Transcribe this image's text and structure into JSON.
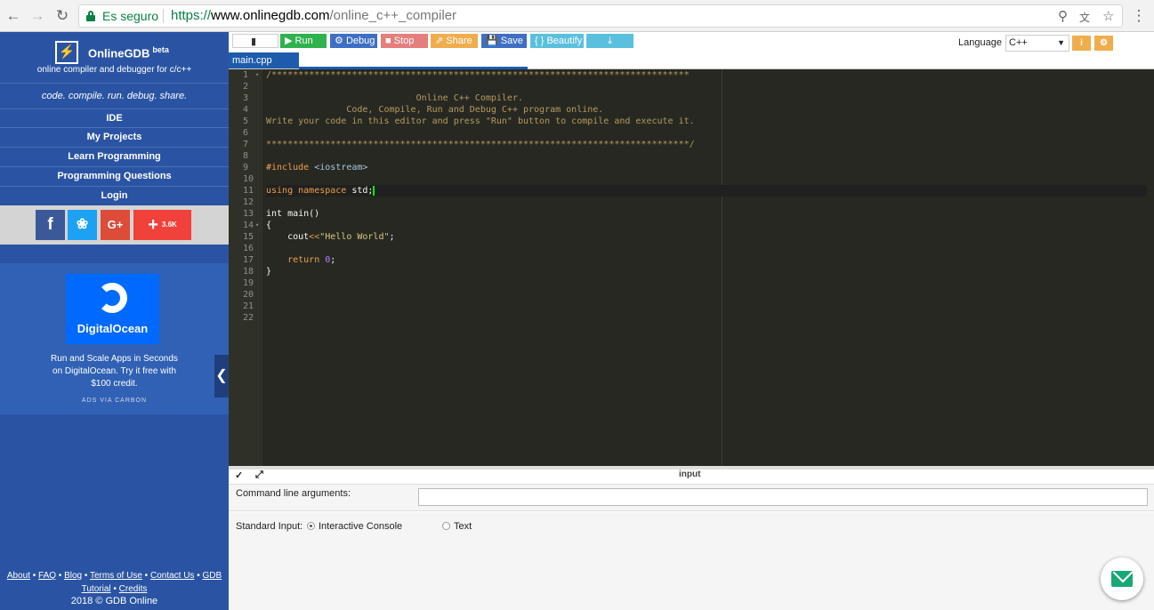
{
  "browser": {
    "security_label": "Es seguro",
    "url_scheme": "https://",
    "url_host": "www.onlinegdb.com",
    "url_path": "/online_c++_compiler"
  },
  "sidebar": {
    "brand": "OnlineGDB",
    "brand_sup": "beta",
    "subtitle": "online compiler and debugger for c/c++",
    "tagline": "code. compile. run. debug. share.",
    "menu": [
      {
        "label": "IDE"
      },
      {
        "label": "My Projects"
      },
      {
        "label": "Learn Programming"
      },
      {
        "label": "Programming Questions"
      },
      {
        "label": "Login"
      }
    ],
    "share_count": "3.6K",
    "ad": {
      "brand": "DigitalOcean",
      "text": "Run and Scale Apps in Seconds on DigitalOcean. Try it free with $100 credit.",
      "via": "ADS VIA CARBON"
    },
    "footer_links": [
      "About",
      "FAQ",
      "Blog",
      "Terms of Use",
      "Contact Us",
      "GDB Tutorial",
      "Credits"
    ],
    "copyright": "2018 © GDB Online"
  },
  "toolbar": {
    "run": "Run",
    "debug": "Debug",
    "stop": "Stop",
    "share": "Share",
    "save": "Save",
    "beautify": "{ } Beautify",
    "language_label": "Language",
    "language_value": "C++",
    "colors": {
      "run": "#2eb24e",
      "debug": "#3e6fc4",
      "stop": "#e57f7d",
      "share": "#f0ad4e",
      "save": "#3e6fc4",
      "beautify": "#5bc0de",
      "download": "#5bc0de"
    }
  },
  "editor": {
    "tab": "main.cpp",
    "lines": [
      "/******************************************************************************",
      "",
      "                            Online C++ Compiler.",
      "               Code, Compile, Run and Debug C++ program online.",
      "Write your code in this editor and press \"Run\" button to compile and execute it.",
      "",
      "*******************************************************************************/",
      "",
      "#include <iostream>",
      "",
      "using namespace std;",
      "",
      "int main()",
      "{",
      "    cout<<\"Hello World\";",
      "",
      "    return 0;",
      "}",
      "",
      "",
      "",
      ""
    ]
  },
  "input_panel": {
    "title": "input",
    "args_label": "Command line arguments:",
    "args_value": "",
    "stdin_label": "Standard Input:",
    "option_console": "Interactive Console",
    "option_text": "Text",
    "selected": "Interactive Console"
  }
}
